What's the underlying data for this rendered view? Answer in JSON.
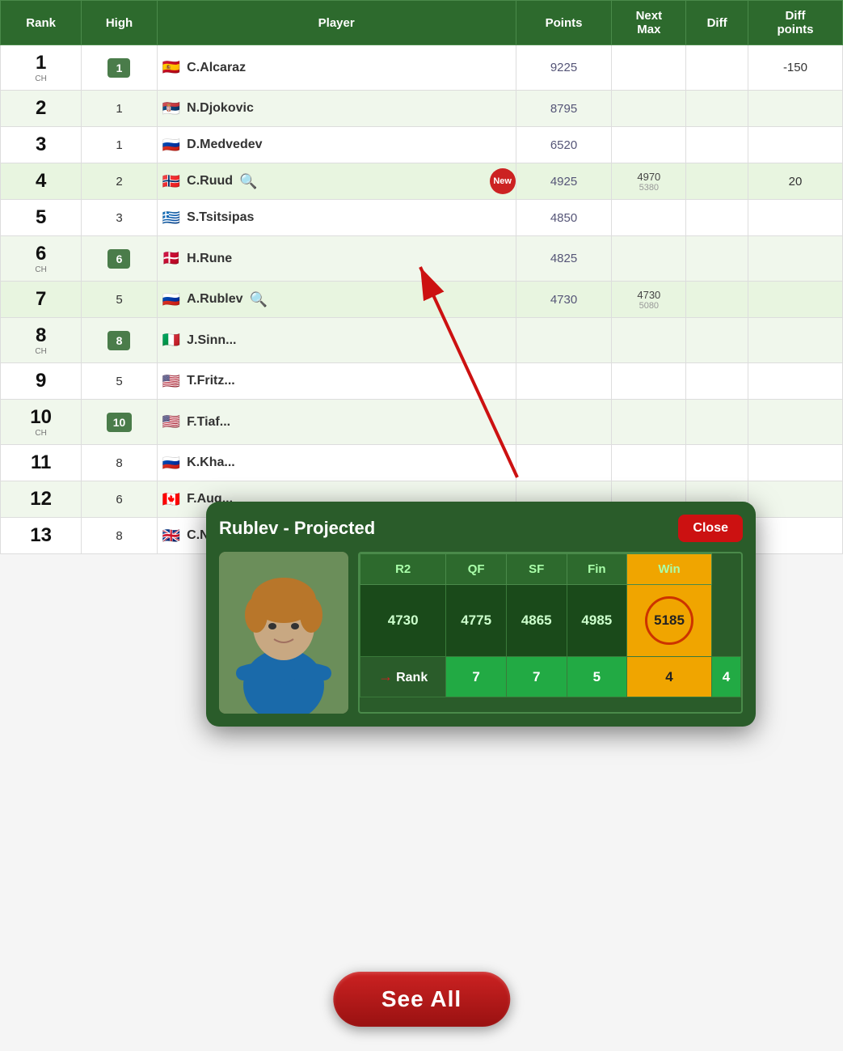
{
  "header": {
    "rank_col": "Rank",
    "high_col": "High",
    "player_col": "Player",
    "points_col": "Points",
    "next_max_col": "Next Max",
    "diff_col": "Diff",
    "diff_points_col": "Diff points"
  },
  "rows": [
    {
      "rank": "1",
      "rank_sub": "CH",
      "high": "1",
      "high_badge": true,
      "player": "C.Alcaraz",
      "flag": "🇪🇸",
      "points": "9225",
      "next_max": "",
      "next_max_sub": "",
      "diff": "",
      "diff_points": "-150",
      "has_search": false,
      "has_new": false
    },
    {
      "rank": "2",
      "rank_sub": "",
      "high": "1",
      "high_badge": false,
      "player": "N.Djokovic",
      "flag": "🇷🇸",
      "points": "8795",
      "next_max": "",
      "next_max_sub": "",
      "diff": "",
      "diff_points": "",
      "has_search": false,
      "has_new": false
    },
    {
      "rank": "3",
      "rank_sub": "",
      "high": "1",
      "high_badge": false,
      "player": "D.Medvedev",
      "flag": "🇷🇺",
      "points": "6520",
      "next_max": "",
      "next_max_sub": "",
      "diff": "",
      "diff_points": "",
      "has_search": false,
      "has_new": false
    },
    {
      "rank": "4",
      "rank_sub": "",
      "high": "2",
      "high_badge": false,
      "player": "C.Ruud",
      "flag": "🇳🇴",
      "points": "4925",
      "next_max": "4970",
      "next_max_sub": "5380",
      "diff": "",
      "diff_points": "20",
      "has_search": true,
      "has_new": true
    },
    {
      "rank": "5",
      "rank_sub": "",
      "high": "3",
      "high_badge": false,
      "player": "S.Tsitsipas",
      "flag": "🇬🇷",
      "points": "4850",
      "next_max": "",
      "next_max_sub": "",
      "diff": "",
      "diff_points": "",
      "has_search": false,
      "has_new": false
    },
    {
      "rank": "6",
      "rank_sub": "CH",
      "high": "6",
      "high_badge": true,
      "player": "H.Rune",
      "flag": "🇩🇰",
      "points": "4825",
      "next_max": "",
      "next_max_sub": "",
      "diff": "",
      "diff_points": "",
      "has_search": false,
      "has_new": false
    },
    {
      "rank": "7",
      "rank_sub": "",
      "high": "5",
      "high_badge": false,
      "player": "A.Rublev",
      "flag": "🇷🇺",
      "points": "4730",
      "next_max": "4730",
      "next_max_sub": "5080",
      "diff": "",
      "diff_points": "",
      "has_search": true,
      "has_new": false
    },
    {
      "rank": "8",
      "rank_sub": "CH",
      "high": "8",
      "high_badge": true,
      "player": "J.Sinn...",
      "flag": "🇮🇹",
      "points": "",
      "next_max": "",
      "next_max_sub": "",
      "diff": "",
      "diff_points": "",
      "has_search": false,
      "has_new": false
    },
    {
      "rank": "9",
      "rank_sub": "",
      "high": "5",
      "high_badge": false,
      "player": "T.Fritz...",
      "flag": "🇺🇸",
      "points": "",
      "next_max": "",
      "next_max_sub": "",
      "diff": "",
      "diff_points": "",
      "has_search": false,
      "has_new": false
    },
    {
      "rank": "10",
      "rank_sub": "CH",
      "high": "10",
      "high_badge": true,
      "player": "F.Tiaf...",
      "flag": "🇺🇸",
      "points": "",
      "next_max": "",
      "next_max_sub": "",
      "diff": "",
      "diff_points": "",
      "has_search": false,
      "has_new": false
    },
    {
      "rank": "11",
      "rank_sub": "",
      "high": "8",
      "high_badge": false,
      "player": "K.Kha...",
      "flag": "🇷🇺",
      "points": "",
      "next_max": "",
      "next_max_sub": "",
      "diff": "",
      "diff_points": "",
      "has_search": false,
      "has_new": false
    },
    {
      "rank": "12",
      "rank_sub": "",
      "high": "6",
      "high_badge": false,
      "player": "F.Aug...",
      "flag": "🇨🇦",
      "points": "",
      "next_max": "",
      "next_max_sub": "",
      "diff": "",
      "diff_points": "",
      "has_search": false,
      "has_new": false
    },
    {
      "rank": "13",
      "rank_sub": "",
      "high": "8",
      "high_badge": false,
      "player": "C.Norrie",
      "flag": "🇬🇧",
      "points": "",
      "next_max": "",
      "next_max_sub": "",
      "diff": "",
      "diff_points": "",
      "has_search": false,
      "has_new": false
    }
  ],
  "popup": {
    "title": "Rublev - Projected",
    "close_label": "Close",
    "columns": [
      "R2",
      "QF",
      "SF",
      "Fin",
      "Win"
    ],
    "points_row": [
      "4730",
      "4775",
      "4865",
      "4985",
      "5185"
    ],
    "rank_label": "Rank",
    "rank_row": [
      "7",
      "7",
      "5",
      "4",
      "4"
    ]
  },
  "see_all_label": "See All"
}
